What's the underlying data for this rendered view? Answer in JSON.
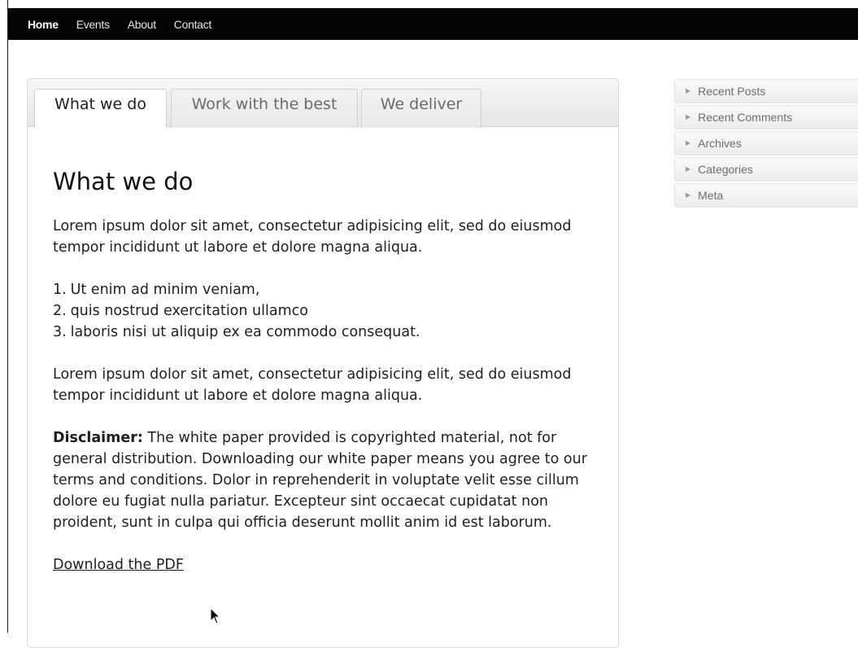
{
  "nav": {
    "items": [
      {
        "label": "Home"
      },
      {
        "label": "Events"
      },
      {
        "label": "About"
      },
      {
        "label": "Contact"
      }
    ]
  },
  "tabs": [
    {
      "label": "What we do"
    },
    {
      "label": "Work with the best"
    },
    {
      "label": "We deliver"
    }
  ],
  "content": {
    "heading": "What we do",
    "para1": "Lorem ipsum dolor sit amet, consectetur adipisicing elit, sed do eiusmod tempor incididunt ut labore et dolore magna aliqua.",
    "list": [
      {
        "num": "1.",
        "text": "Ut enim ad minim veniam,"
      },
      {
        "num": "2.",
        "text": "quis nostrud exercitation ullamco"
      },
      {
        "num": "3.",
        "text": "laboris nisi ut aliquip ex ea commodo consequat."
      }
    ],
    "para2": "Lorem ipsum dolor sit amet, consectetur adipisicing elit, sed do eiusmod tempor incididunt ut labore et dolore magna aliqua.",
    "disclaimer_label": "Disclaimer:",
    "disclaimer_text": " The white paper provided is copyrighted material, not for general distribution. Downloading our white paper means you agree to our terms and conditions. Dolor in reprehenderit in voluptate velit esse cillum dolore eu fugiat nulla pariatur. Excepteur sint occaecat cupidatat non proident, sunt in culpa qui officia deserunt mollit anim id est laborum.",
    "download_link": "Download the PDF"
  },
  "sidebar": {
    "widgets": [
      {
        "label": "Recent Posts",
        "icon": "triangle-right-icon"
      },
      {
        "label": "Recent Comments",
        "icon": "triangle-right-icon"
      },
      {
        "label": "Archives",
        "icon": "triangle-right-icon"
      },
      {
        "label": "Categories",
        "icon": "triangle-right-icon"
      },
      {
        "label": "Meta",
        "icon": "triangle-right-icon"
      }
    ]
  },
  "colors": {
    "nav_bg": "#050505",
    "panel_border": "#d9d9d9",
    "text": "#1f1f1f"
  }
}
